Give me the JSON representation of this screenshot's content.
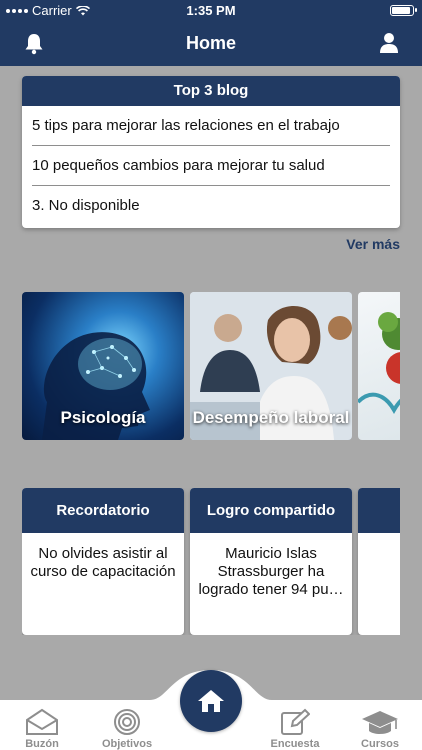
{
  "status_bar": {
    "carrier": "Carrier",
    "time": "1:35 PM"
  },
  "nav": {
    "title": "Home",
    "left_icon": "bell-icon",
    "right_icon": "user-icon"
  },
  "blog": {
    "title": "Top 3 blog",
    "items": [
      "5 tips para mejorar las relaciones en el trabajo",
      "10 pequeños cambios para mejorar tu salud",
      "3. No disponible"
    ],
    "more_label": "Ver más"
  },
  "categories": [
    {
      "label": "Psicología"
    },
    {
      "label": "Desempeño laboral"
    },
    {
      "label": ""
    }
  ],
  "cards": [
    {
      "title": "Recordatorio",
      "body": "No olvides asistir al curso de capacitación"
    },
    {
      "title": "Logro compartido",
      "body": "Mauricio Islas Strassburger ha logrado tener 94 pu…"
    }
  ],
  "tabs": [
    {
      "label": "Buzón",
      "icon": "envelope-icon"
    },
    {
      "label": "Objetivos",
      "icon": "target-icon"
    },
    {
      "label": "",
      "icon": "home-icon"
    },
    {
      "label": "Encuesta",
      "icon": "edit-icon"
    },
    {
      "label": "Cursos",
      "icon": "graduation-cap-icon"
    }
  ],
  "colors": {
    "primary": "#213a63",
    "background": "#a9a9a9",
    "tab_inactive": "#8e8e8e"
  }
}
